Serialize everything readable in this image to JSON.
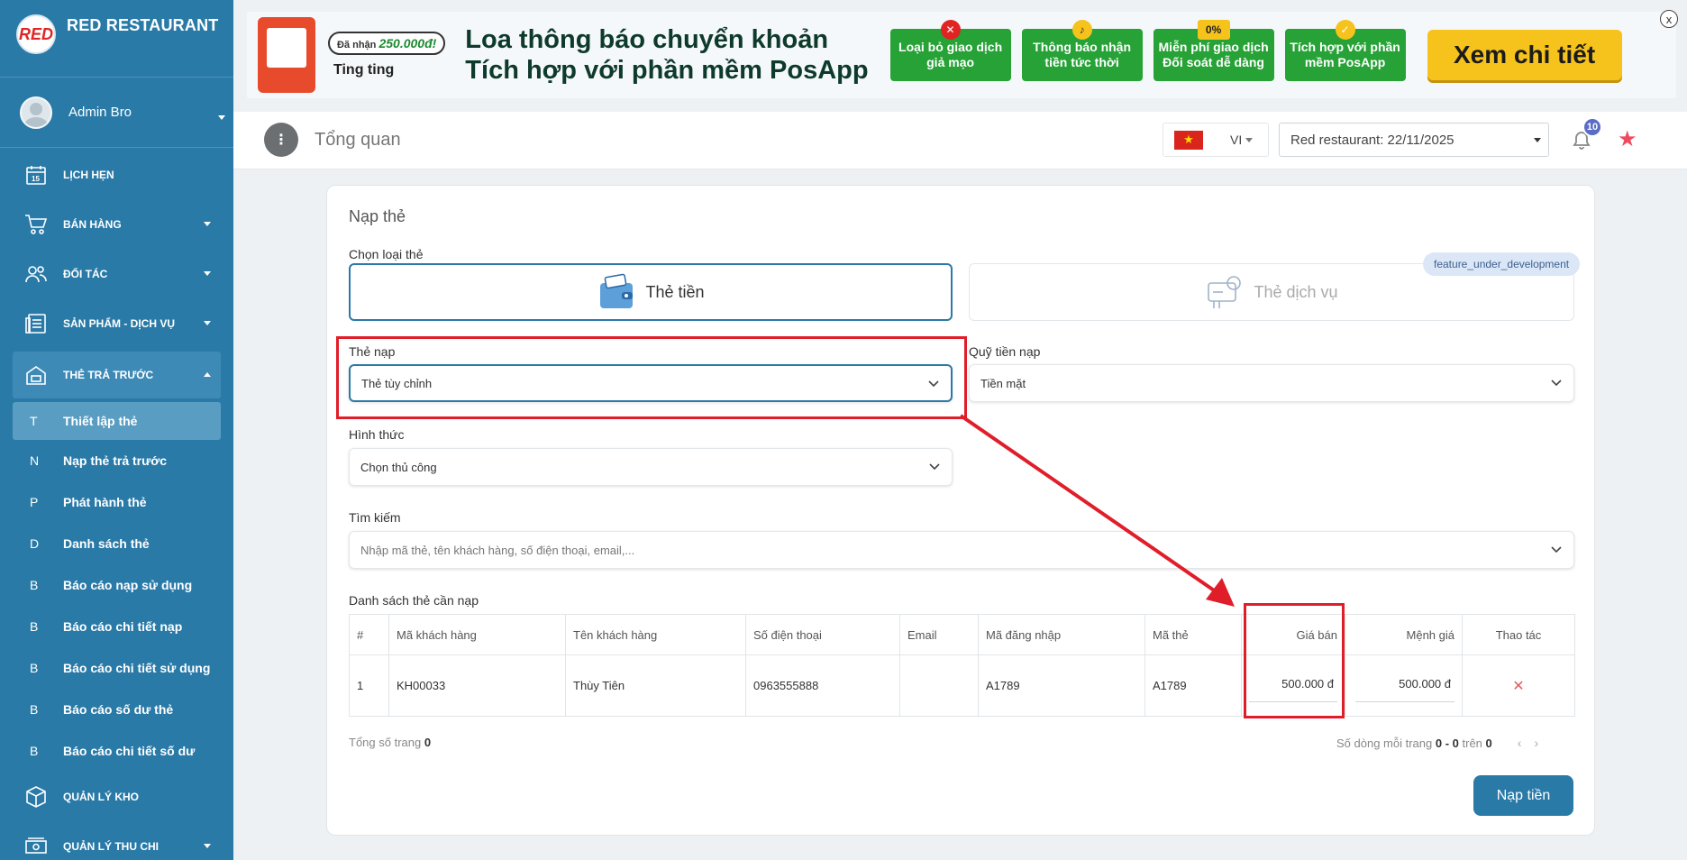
{
  "sidebar": {
    "brand_name": "RED RESTAURANT",
    "logo_text": "RED",
    "user_name": "Admin Bro",
    "menu": [
      {
        "label": "LỊCH HẸN"
      },
      {
        "label": "BÁN HÀNG"
      },
      {
        "label": "ĐỐI TÁC"
      },
      {
        "label": "SẢN PHẨM - DỊCH VỤ"
      },
      {
        "label": "THẺ TRẢ TRƯỚC"
      },
      {
        "label": "QUẢN LÝ KHO"
      },
      {
        "label": "QUẢN LÝ THU CHI"
      }
    ],
    "calendar_day": "15",
    "subitems": [
      {
        "letter": "T",
        "label": "Thiết lập thẻ"
      },
      {
        "letter": "N",
        "label": "Nạp thẻ trả trước"
      },
      {
        "letter": "P",
        "label": "Phát hành thẻ"
      },
      {
        "letter": "D",
        "label": "Danh sách thẻ"
      },
      {
        "letter": "B",
        "label": "Báo cáo nạp sử dụng"
      },
      {
        "letter": "B",
        "label": "Báo cáo chi tiết nạp"
      },
      {
        "letter": "B",
        "label": "Báo cáo chi tiết sử dụng"
      },
      {
        "letter": "B",
        "label": "Báo cáo số dư thẻ"
      },
      {
        "letter": "B",
        "label": "Báo cáo chi tiết số dư"
      }
    ]
  },
  "banner": {
    "received_prefix": "Đã nhận",
    "received_amount": "250.000đ!",
    "ting": "Ting ting",
    "headline_1": "Loa thông báo chuyển khoản",
    "headline_2": "Tích hợp với phần mềm PosApp",
    "tiles": [
      {
        "text": "Loại bỏ giao dịch giả mạo",
        "mark": "✕"
      },
      {
        "text": "Thông báo nhận tiền tức thời",
        "mark": "♪"
      },
      {
        "text": "Miễn phí giao dịch Đối soát dễ dàng",
        "mark": "0%"
      },
      {
        "text": "Tích hợp với phần mềm PosApp",
        "mark": "✓"
      }
    ],
    "cta": "Xem chi tiết",
    "close": "x"
  },
  "header": {
    "menu_dots": "⋮",
    "title": "Tổng quan",
    "flag_star": "★",
    "lang_code": "VI",
    "store_select": "Red restaurant: 22/11/2025",
    "notification_count": "10",
    "favorite_star": "★"
  },
  "form": {
    "title": "Nạp thẻ",
    "card_type_label": "Chọn loại thẻ",
    "card_type_money": "Thẻ tiền",
    "card_type_service": "Thẻ dịch vụ",
    "dev_badge": "feature_under_development",
    "topup_card_label": "Thẻ nạp",
    "topup_card_value": "Thẻ tùy chỉnh",
    "fund_label": "Quỹ tiền nạp",
    "fund_value": "Tiền mặt",
    "method_label": "Hình thức",
    "method_value": "Chọn thủ công",
    "search_label": "Tìm kiếm",
    "search_placeholder": "Nhập mã thẻ, tên khách hàng, số điện thoại, email,...",
    "list_label": "Danh sách thẻ cần nạp"
  },
  "table": {
    "headers": [
      "#",
      "Mã khách hàng",
      "Tên khách hàng",
      "Số điện thoại",
      "Email",
      "Mã đăng nhập",
      "Mã thẻ",
      "Giá bán",
      "Mệnh giá",
      "Thao tác"
    ],
    "rows": [
      {
        "index": "1",
        "customer_code": "KH00033",
        "customer_name": "Thùy Tiên",
        "phone": "0963555888",
        "email": "",
        "login_code": "A1789",
        "card_code": "A1789",
        "sale_price": "500.000 đ",
        "face_value": "500.000 đ",
        "delete": "✕"
      }
    ]
  },
  "footer": {
    "total_pages_label": "Tổng số trang",
    "total_pages": "0",
    "rows_per_page_label": "Số dòng mỗi trang",
    "range": "0 - 0",
    "of_label": "trên",
    "total": "0",
    "prev": "‹",
    "next": "›",
    "submit": "Nạp tiền"
  },
  "colors": {
    "sidebar": "#2a7aa8",
    "primary": "#2a7aa8",
    "highlight": "#e01e2a",
    "notification": "#5b6cc7",
    "favorite": "#ef4b5e"
  }
}
